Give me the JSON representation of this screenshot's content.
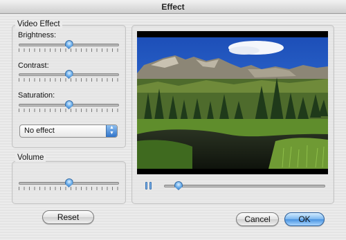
{
  "window": {
    "title": "Effect"
  },
  "video_effect": {
    "title": "Video Effect",
    "brightness": {
      "label": "Brightness:",
      "value": 0.5
    },
    "contrast": {
      "label": "Contrast:",
      "value": 0.5
    },
    "saturation": {
      "label": "Saturation:",
      "value": 0.5
    },
    "effect_select": {
      "selected": "No effect"
    }
  },
  "volume": {
    "title": "Volume",
    "value": 0.5
  },
  "player": {
    "progress": 0.09
  },
  "buttons": {
    "reset": "Reset",
    "cancel": "Cancel",
    "ok": "OK"
  },
  "colors": {
    "accent": "#4a93e0",
    "thumb": "#6fb1ec"
  }
}
